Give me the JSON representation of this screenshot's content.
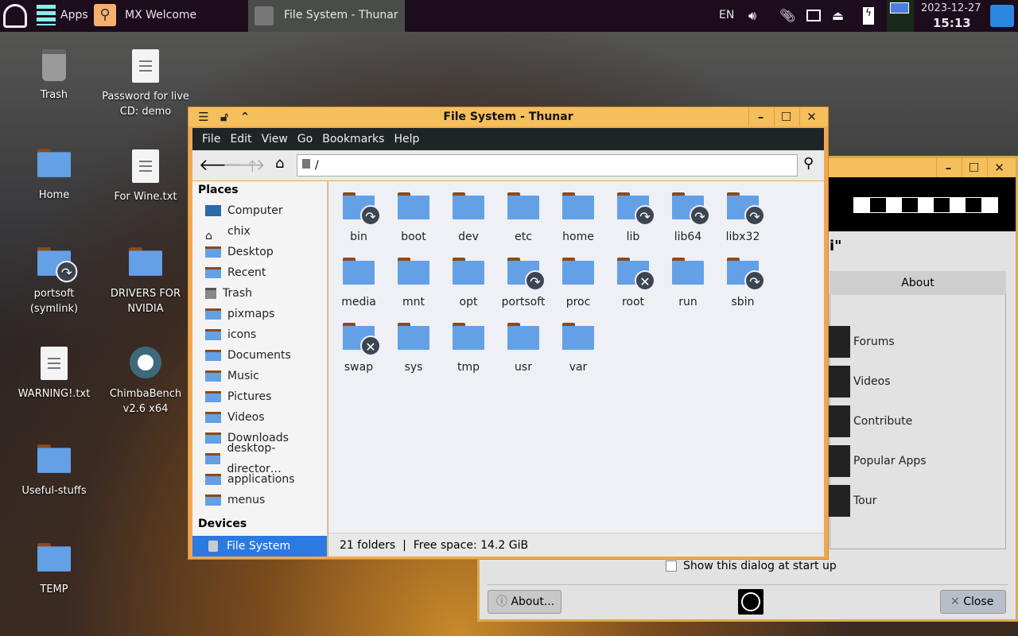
{
  "taskbar": {
    "apps_label": "Apps",
    "welcome_label": "MX Welcome",
    "active_window": "File System - Thunar",
    "lang": "EN",
    "date": "2023-12-27",
    "time": "15:13"
  },
  "desktop": [
    {
      "label": "Trash",
      "type": "trash"
    },
    {
      "label": "Password for live CD: demo",
      "type": "doc"
    },
    {
      "label": "Home",
      "type": "home"
    },
    {
      "label": "For Wine.txt",
      "type": "doc"
    },
    {
      "label": "portsoft (symlink)",
      "type": "link"
    },
    {
      "label": "DRIVERS FOR NVIDIA",
      "type": "folder"
    },
    {
      "label": "WARNING!.txt",
      "type": "doc"
    },
    {
      "label": "ChimbaBench v2.6 x64",
      "type": "gear"
    },
    {
      "label": "Useful-stuffs",
      "type": "folder"
    },
    {
      "label": "TEMP",
      "type": "folder"
    }
  ],
  "thunar": {
    "title": "File System - Thunar",
    "menu": [
      "File",
      "Edit",
      "View",
      "Go",
      "Bookmarks",
      "Help"
    ],
    "location": "/",
    "places_header": "Places",
    "places": [
      "Computer",
      "chix",
      "Desktop",
      "Recent",
      "Trash",
      "pixmaps",
      "icons",
      "Documents",
      "Music",
      "Pictures",
      "Videos",
      "Downloads",
      "desktop-director…",
      "applications",
      "menus"
    ],
    "devices_header": "Devices",
    "devices": [
      "File System"
    ],
    "folders": [
      {
        "n": "bin",
        "b": "link"
      },
      {
        "n": "boot"
      },
      {
        "n": "dev"
      },
      {
        "n": "etc"
      },
      {
        "n": "home"
      },
      {
        "n": "lib",
        "b": "link"
      },
      {
        "n": "lib64",
        "b": "link"
      },
      {
        "n": "libx32",
        "b": "link"
      },
      {
        "n": "media"
      },
      {
        "n": "mnt"
      },
      {
        "n": "opt"
      },
      {
        "n": "portsoft",
        "b": "link"
      },
      {
        "n": "proc"
      },
      {
        "n": "root",
        "b": "x"
      },
      {
        "n": "run"
      },
      {
        "n": "sbin",
        "b": "link"
      },
      {
        "n": "swap",
        "b": "x"
      },
      {
        "n": "sys"
      },
      {
        "n": "tmp"
      },
      {
        "n": "usr"
      },
      {
        "n": "var"
      }
    ],
    "status": "21 folders  |  Free space: 14.2 GiB"
  },
  "welcome": {
    "heading_fragment": "i\"",
    "tab": "About",
    "links": [
      "Forums",
      "Videos",
      "Contribute",
      "Popular Apps",
      "Tour"
    ],
    "checkbox": "Show this dialog at start up",
    "about_btn": "About...",
    "close_btn": "Close"
  }
}
